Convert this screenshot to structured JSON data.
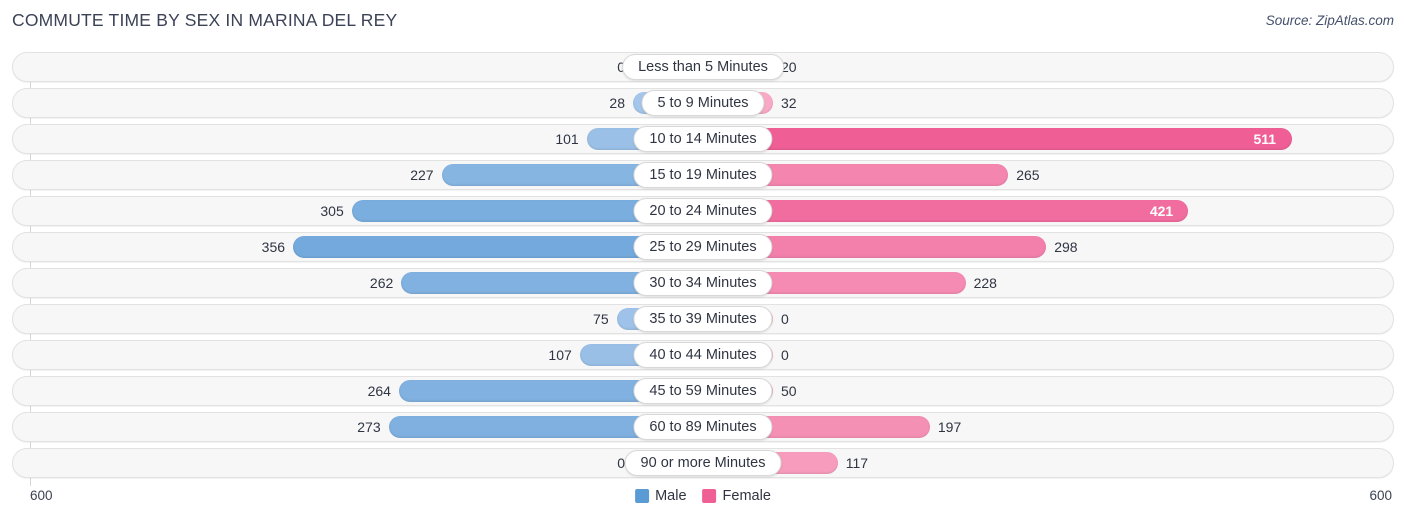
{
  "header": {
    "title": "COMMUTE TIME BY SEX IN MARINA DEL REY",
    "source": "Source: ZipAtlas.com"
  },
  "legend": {
    "items": [
      {
        "label": "Male",
        "color": "#5b9bd5"
      },
      {
        "label": "Female",
        "color": "#ef5f96"
      }
    ]
  },
  "axis": {
    "left_tick": "600",
    "right_tick": "600",
    "max": 600
  },
  "colors": {
    "male_dark": "#5b9bd5",
    "male_light": "#a9c9ec",
    "female_dark": "#ef5f96",
    "female_light": "#f9aec8",
    "track": "#f7f7f7",
    "track_border": "#e2e2e2"
  },
  "chart_data": {
    "type": "bar",
    "orientation": "horizontal-diverging",
    "title": "COMMUTE TIME BY SEX IN MARINA DEL REY",
    "xlabel": "",
    "ylabel": "",
    "xlim": [
      600,
      600
    ],
    "grid": false,
    "legend_position": "bottom-center",
    "categories": [
      "Less than 5 Minutes",
      "5 to 9 Minutes",
      "10 to 14 Minutes",
      "15 to 19 Minutes",
      "20 to 24 Minutes",
      "25 to 29 Minutes",
      "30 to 34 Minutes",
      "35 to 39 Minutes",
      "40 to 44 Minutes",
      "45 to 59 Minutes",
      "60 to 89 Minutes",
      "90 or more Minutes"
    ],
    "series": [
      {
        "name": "Male",
        "values": [
          0,
          28,
          101,
          227,
          305,
          356,
          262,
          75,
          107,
          264,
          273,
          0
        ]
      },
      {
        "name": "Female",
        "values": [
          20,
          32,
          511,
          265,
          421,
          298,
          228,
          0,
          0,
          50,
          197,
          117
        ]
      }
    ]
  },
  "rows": [
    {
      "label": "Less than 5 Minutes",
      "male": 0,
      "male_text": "0",
      "female": 20,
      "female_text": "20"
    },
    {
      "label": "5 to 9 Minutes",
      "male": 28,
      "male_text": "28",
      "female": 32,
      "female_text": "32"
    },
    {
      "label": "10 to 14 Minutes",
      "male": 101,
      "male_text": "101",
      "female": 511,
      "female_text": "511"
    },
    {
      "label": "15 to 19 Minutes",
      "male": 227,
      "male_text": "227",
      "female": 265,
      "female_text": "265"
    },
    {
      "label": "20 to 24 Minutes",
      "male": 305,
      "male_text": "305",
      "female": 421,
      "female_text": "421"
    },
    {
      "label": "25 to 29 Minutes",
      "male": 356,
      "male_text": "356",
      "female": 298,
      "female_text": "298"
    },
    {
      "label": "30 to 34 Minutes",
      "male": 262,
      "male_text": "262",
      "female": 228,
      "female_text": "228"
    },
    {
      "label": "35 to 39 Minutes",
      "male": 75,
      "male_text": "75",
      "female": 0,
      "female_text": "0"
    },
    {
      "label": "40 to 44 Minutes",
      "male": 107,
      "male_text": "107",
      "female": 0,
      "female_text": "0"
    },
    {
      "label": "45 to 59 Minutes",
      "male": 264,
      "male_text": "264",
      "female": 50,
      "female_text": "50"
    },
    {
      "label": "60 to 89 Minutes",
      "male": 273,
      "male_text": "273",
      "female": 197,
      "female_text": "197"
    },
    {
      "label": "90 or more Minutes",
      "male": 0,
      "male_text": "0",
      "female": 117,
      "female_text": "117"
    }
  ]
}
